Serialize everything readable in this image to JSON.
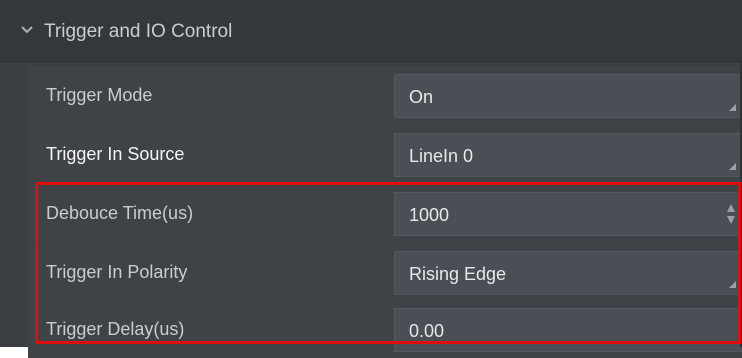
{
  "section": {
    "title": "Trigger and IO Control",
    "icon": "chevron-down-icon",
    "expanded": true
  },
  "rows": [
    {
      "label": "Trigger Mode",
      "value": "On",
      "control": "dropdown"
    },
    {
      "label": "Trigger In Source",
      "value": "LineIn 0",
      "control": "dropdown"
    },
    {
      "label": "Debouce Time(us)",
      "value": "1000",
      "control": "spinner"
    },
    {
      "label": "Trigger In Polarity",
      "value": "Rising Edge",
      "control": "dropdown"
    },
    {
      "label": "Trigger Delay(us)",
      "value": "0.00",
      "control": "text"
    }
  ],
  "colors": {
    "panel_bg": "#3b3f44",
    "row_bg": "#3f4348",
    "value_bg": "#4a4f55",
    "highlight": "#e00d0d"
  }
}
